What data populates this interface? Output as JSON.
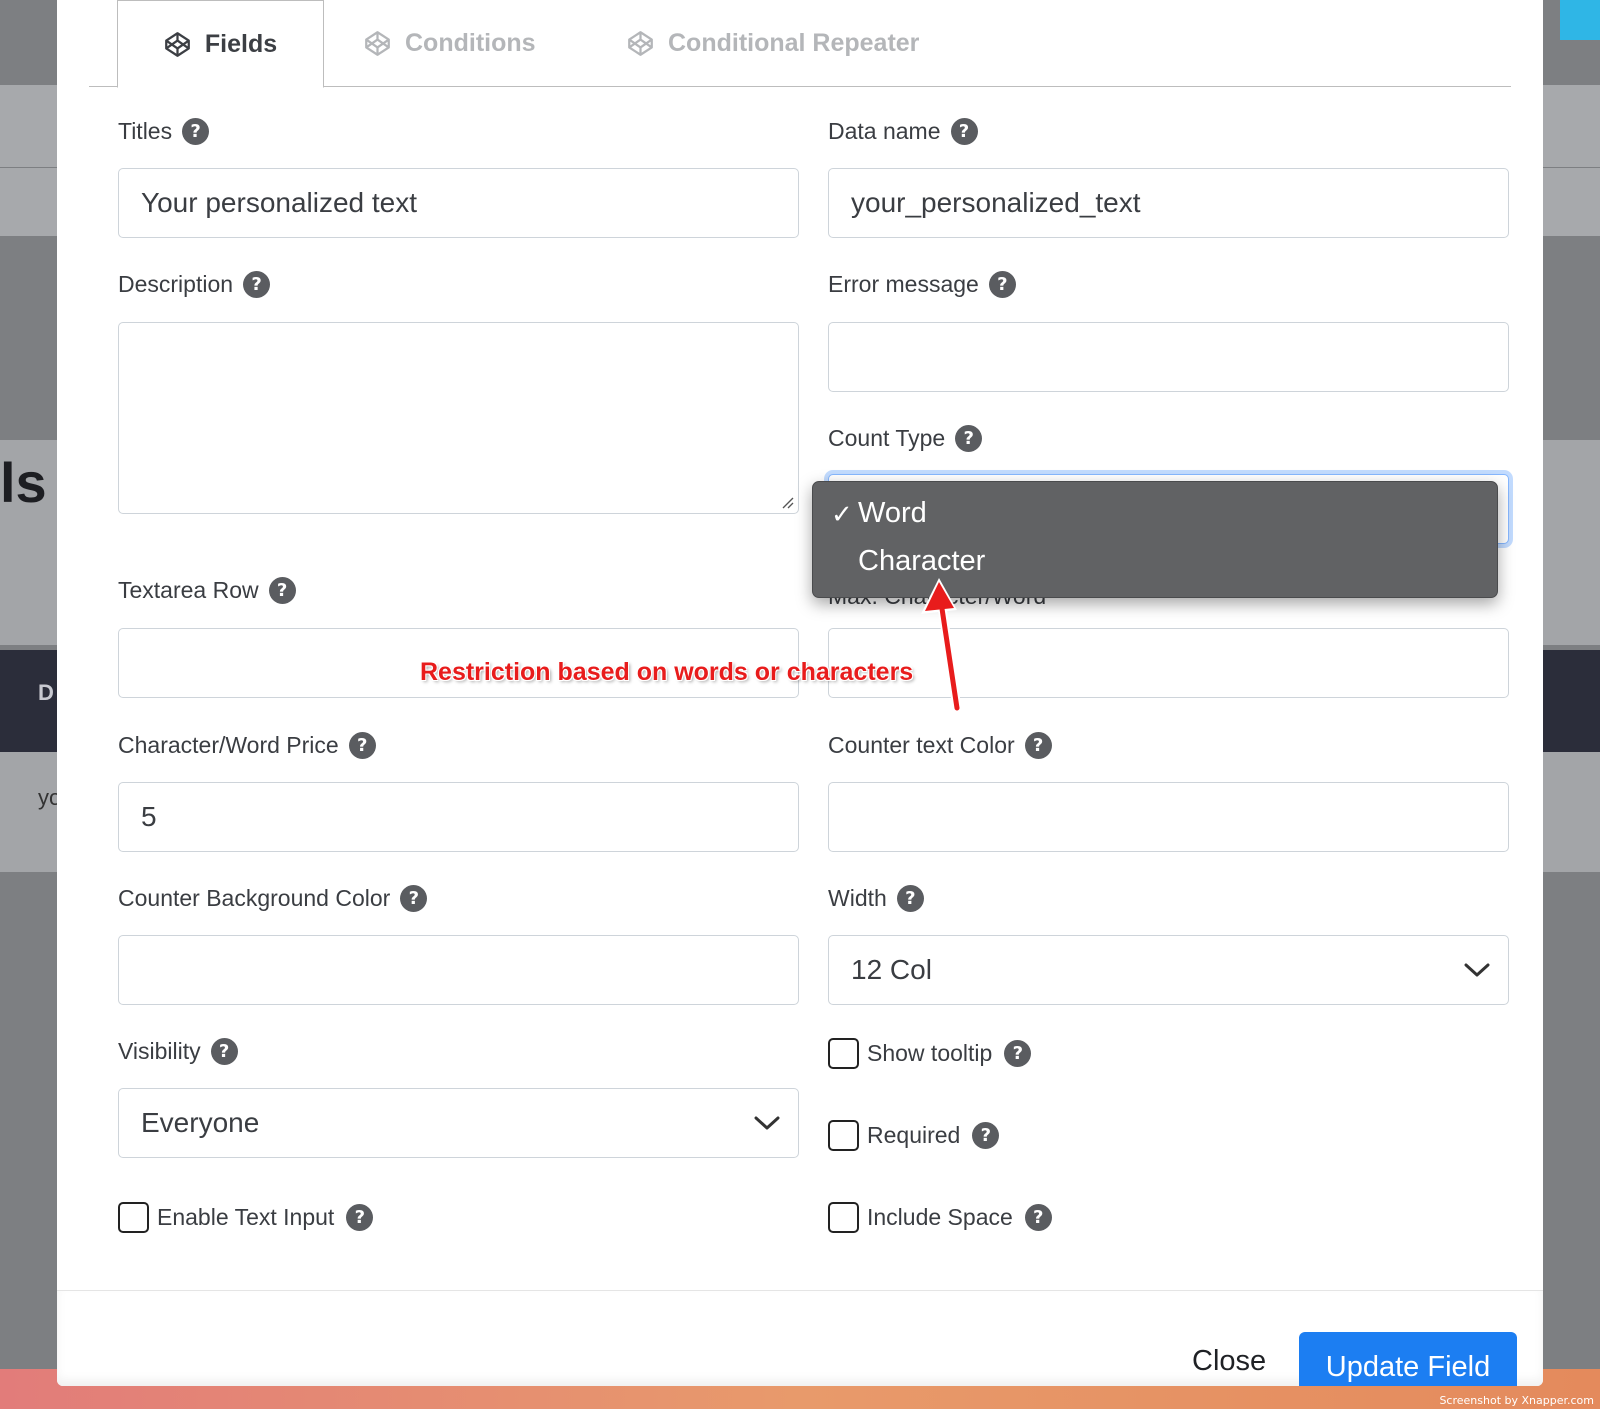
{
  "background": {
    "heading_fragment": "ls",
    "dark_letter": "D",
    "small_fragment": "yo"
  },
  "tabs": [
    {
      "label": "Fields",
      "active": true
    },
    {
      "label": "Conditions",
      "active": false
    },
    {
      "label": "Conditional Repeater",
      "active": false
    }
  ],
  "form": {
    "titles": {
      "label": "Titles",
      "value": "Your personalized text"
    },
    "data_name": {
      "label": "Data name",
      "value": "your_personalized_text"
    },
    "description": {
      "label": "Description",
      "value": ""
    },
    "error_message": {
      "label": "Error message",
      "value": ""
    },
    "count_type": {
      "label": "Count Type",
      "options": [
        "Word",
        "Character"
      ],
      "selected": "Word"
    },
    "textarea_row": {
      "label": "Textarea Row",
      "value": ""
    },
    "max_char_word": {
      "label": "Max. Character/Word",
      "value": ""
    },
    "char_word_price": {
      "label": "Character/Word Price",
      "value": "5"
    },
    "counter_text_color": {
      "label": "Counter text Color",
      "value": ""
    },
    "counter_bg_color": {
      "label": "Counter Background Color",
      "value": ""
    },
    "width": {
      "label": "Width",
      "value": "12 Col"
    },
    "visibility": {
      "label": "Visibility",
      "value": "Everyone"
    },
    "show_tooltip": {
      "label": "Show tooltip",
      "checked": false
    },
    "required": {
      "label": "Required",
      "checked": false
    },
    "enable_text_input": {
      "label": "Enable Text Input",
      "checked": false
    },
    "include_space": {
      "label": "Include Space",
      "checked": false
    }
  },
  "help_glyph": "?",
  "checkmark": "✓",
  "annotation": "Restriction based on words or characters",
  "footer": {
    "close_label": "Close",
    "update_label": "Update Field"
  },
  "watermark": "Screenshot by Xnapper.com",
  "colors": {
    "primary": "#1c7ef2",
    "annotation": "#e81c1c",
    "dropdown_bg": "#616264"
  }
}
